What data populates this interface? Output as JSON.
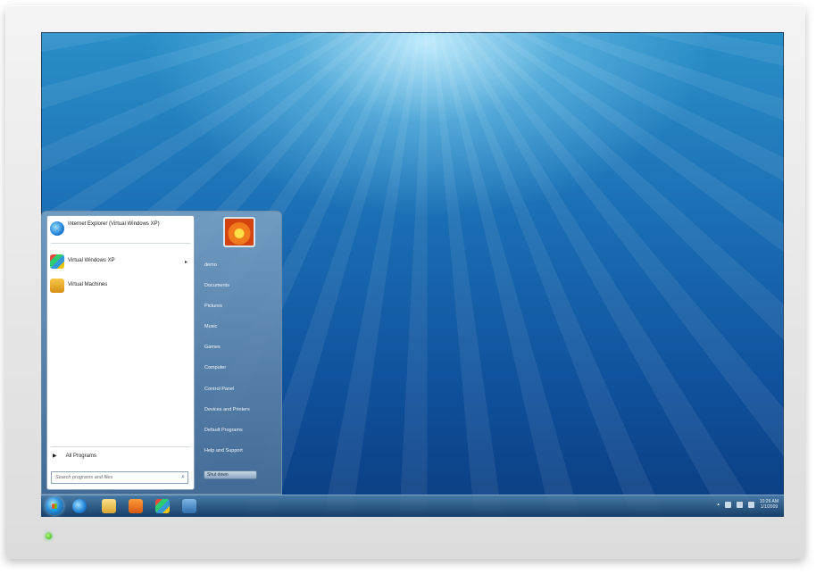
{
  "start_menu": {
    "programs": [
      {
        "label": "Internet Explorer (Virtual Windows XP)",
        "icon": "internet-explorer-icon"
      },
      {
        "label": "Virtual Windows XP",
        "icon": "virtual-windows-xp-icon"
      },
      {
        "label": "Virtual Machines",
        "icon": "virtual-machines-icon"
      }
    ],
    "all_programs": "All Programs",
    "search_placeholder": "Search programs and files",
    "right_items": [
      "demo",
      "Documents",
      "Pictures",
      "Music",
      "Games",
      "Computer",
      "Control Panel",
      "Devices and Printers",
      "Default Programs",
      "Help and Support"
    ],
    "shutdown_label": "Shut down"
  },
  "taskbar": {
    "clock_time": "10:26 AM",
    "clock_date": "1/1/2009"
  },
  "colors": {
    "desktop_blue": "#1a6db3",
    "power_led": "#2ea51c"
  }
}
